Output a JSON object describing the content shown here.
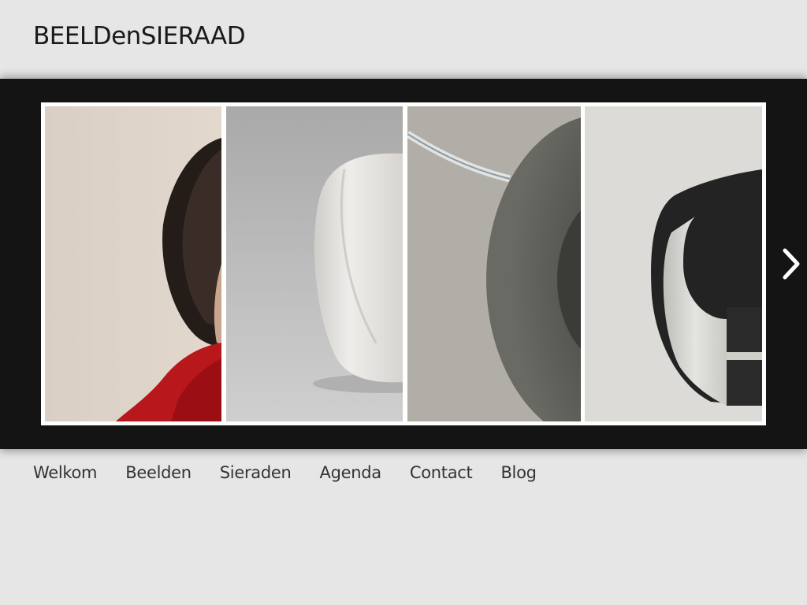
{
  "header": {
    "site_title": "BEELDenSIERAAD"
  },
  "slider": {
    "slides": [
      {
        "subject": "portrait-woman-red-blouse"
      },
      {
        "subject": "white-ceramic-sculpture"
      },
      {
        "subject": "steel-ring-necklace"
      },
      {
        "subject": "silver-bracelet"
      }
    ],
    "next_icon": "chevron-right-icon"
  },
  "nav": {
    "items": [
      {
        "label": "Welkom"
      },
      {
        "label": "Beelden"
      },
      {
        "label": "Sieraden"
      },
      {
        "label": "Agenda"
      },
      {
        "label": "Contact"
      },
      {
        "label": "Blog"
      }
    ]
  },
  "colors": {
    "page_bg": "#e6e6e6",
    "slider_bg": "#141414",
    "frame": "#ffffff"
  }
}
